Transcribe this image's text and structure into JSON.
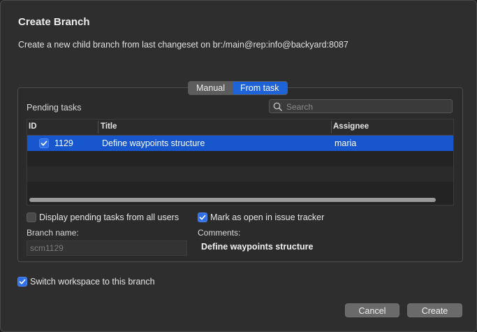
{
  "dialog": {
    "title": "Create Branch",
    "subtitle": "Create a new child branch from last changeset on br:/main@rep:info@backyard:8087"
  },
  "mode_tabs": [
    {
      "label": "Manual",
      "active": false
    },
    {
      "label": "From task",
      "active": true
    }
  ],
  "pending": {
    "label": "Pending tasks",
    "search_placeholder": "Search",
    "columns": {
      "id": "ID",
      "title": "Title",
      "assignee": "Assignee"
    },
    "rows": [
      {
        "id": "1129",
        "title": "Define waypoints structure",
        "assignee": "maria",
        "checked": true,
        "selected": true
      }
    ]
  },
  "options": {
    "display_all_label": "Display pending tasks from all users",
    "display_all_checked": false,
    "mark_open_label": "Mark as open in issue tracker",
    "mark_open_checked": true
  },
  "branch": {
    "name_label": "Branch name:",
    "name_value": "scm1129"
  },
  "comments": {
    "label": "Comments:",
    "value": "Define waypoints structure"
  },
  "switch_workspace": {
    "label": "Switch workspace to this branch",
    "checked": true
  },
  "buttons": {
    "cancel": "Cancel",
    "create": "Create"
  },
  "colors": {
    "accent": "#1f63d8",
    "selection": "#1756cc",
    "background": "#2e2e2e"
  }
}
